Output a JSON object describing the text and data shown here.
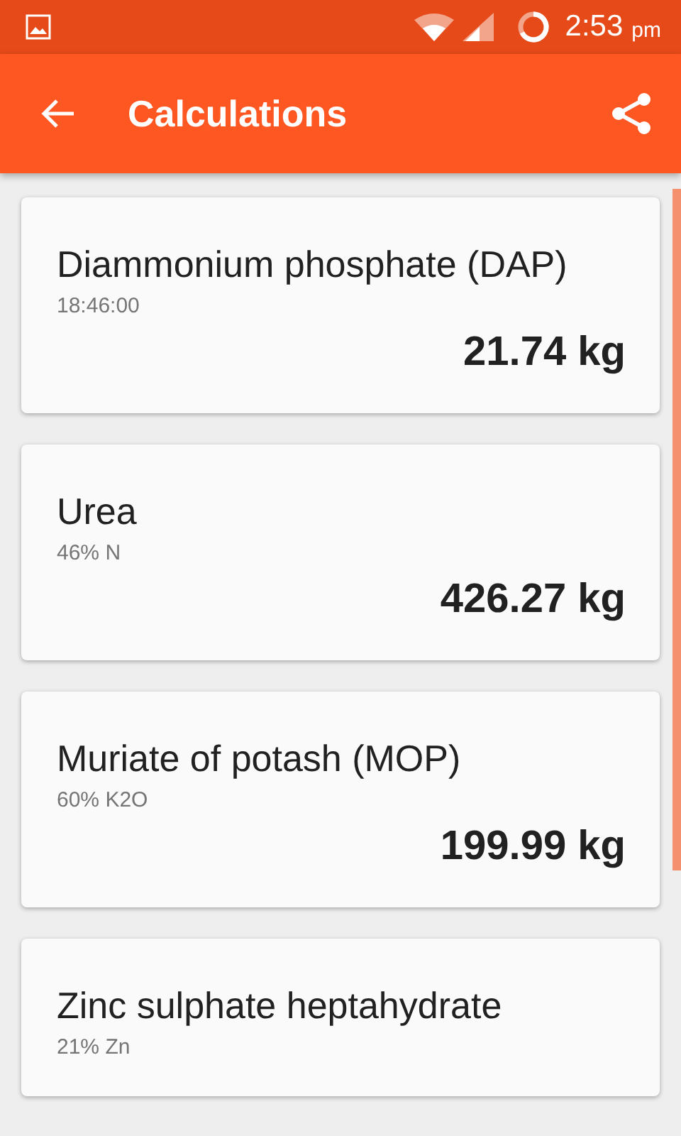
{
  "status_bar": {
    "time": "2:53",
    "period": "pm"
  },
  "toolbar": {
    "title": "Calculations"
  },
  "cards": [
    {
      "title": "Diammonium phosphate (DAP)",
      "subtitle": "18:46:00",
      "amount": "21.74 kg"
    },
    {
      "title": "Urea",
      "subtitle": "46% N",
      "amount": "426.27 kg"
    },
    {
      "title": "Muriate of potash (MOP)",
      "subtitle": "60% K2O",
      "amount": "199.99 kg"
    },
    {
      "title": "Zinc sulphate heptahydrate",
      "subtitle": "21% Zn"
    }
  ]
}
